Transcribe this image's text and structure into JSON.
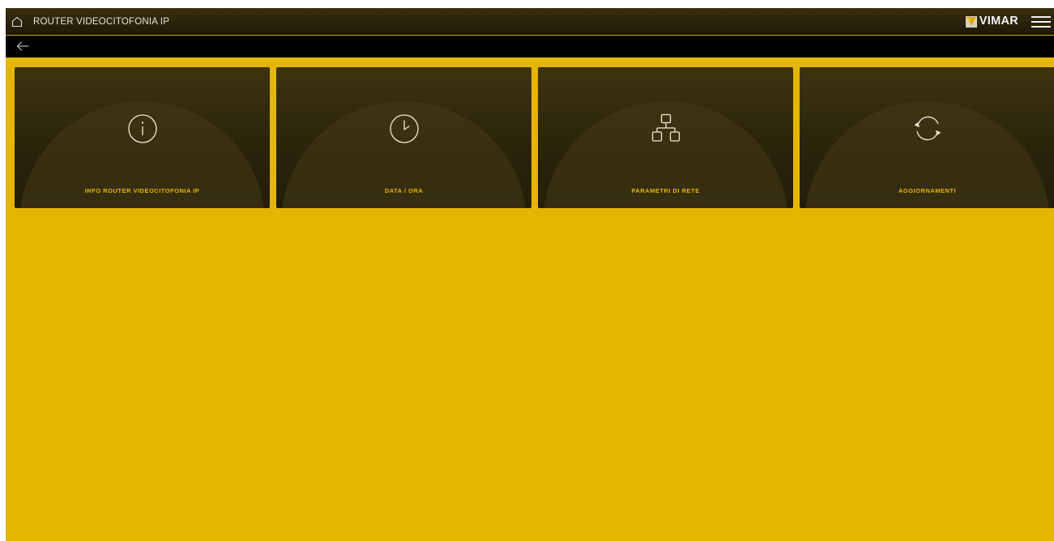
{
  "header": {
    "title": "ROUTER VIDEOCITOFONIA IP",
    "brand_name": "VIMAR",
    "home_icon": "home-icon",
    "menu_icon": "hamburger-menu-icon",
    "back_icon": "back-arrow-icon"
  },
  "tiles": [
    {
      "label": "INFO ROUTER VIDEOCITOFONIA IP",
      "icon": "info-icon"
    },
    {
      "label": "DATA / ORA",
      "icon": "clock-icon"
    },
    {
      "label": "PARAMETRI DI RETE",
      "icon": "network-icon"
    },
    {
      "label": "AGGIORNAMENTI",
      "icon": "refresh-icon"
    }
  ],
  "colors": {
    "background": "#e4b600",
    "tile_background": "#2b240b",
    "tile_label": "#e4b600",
    "topbar": "#2a2209",
    "subbar": "#000000"
  }
}
